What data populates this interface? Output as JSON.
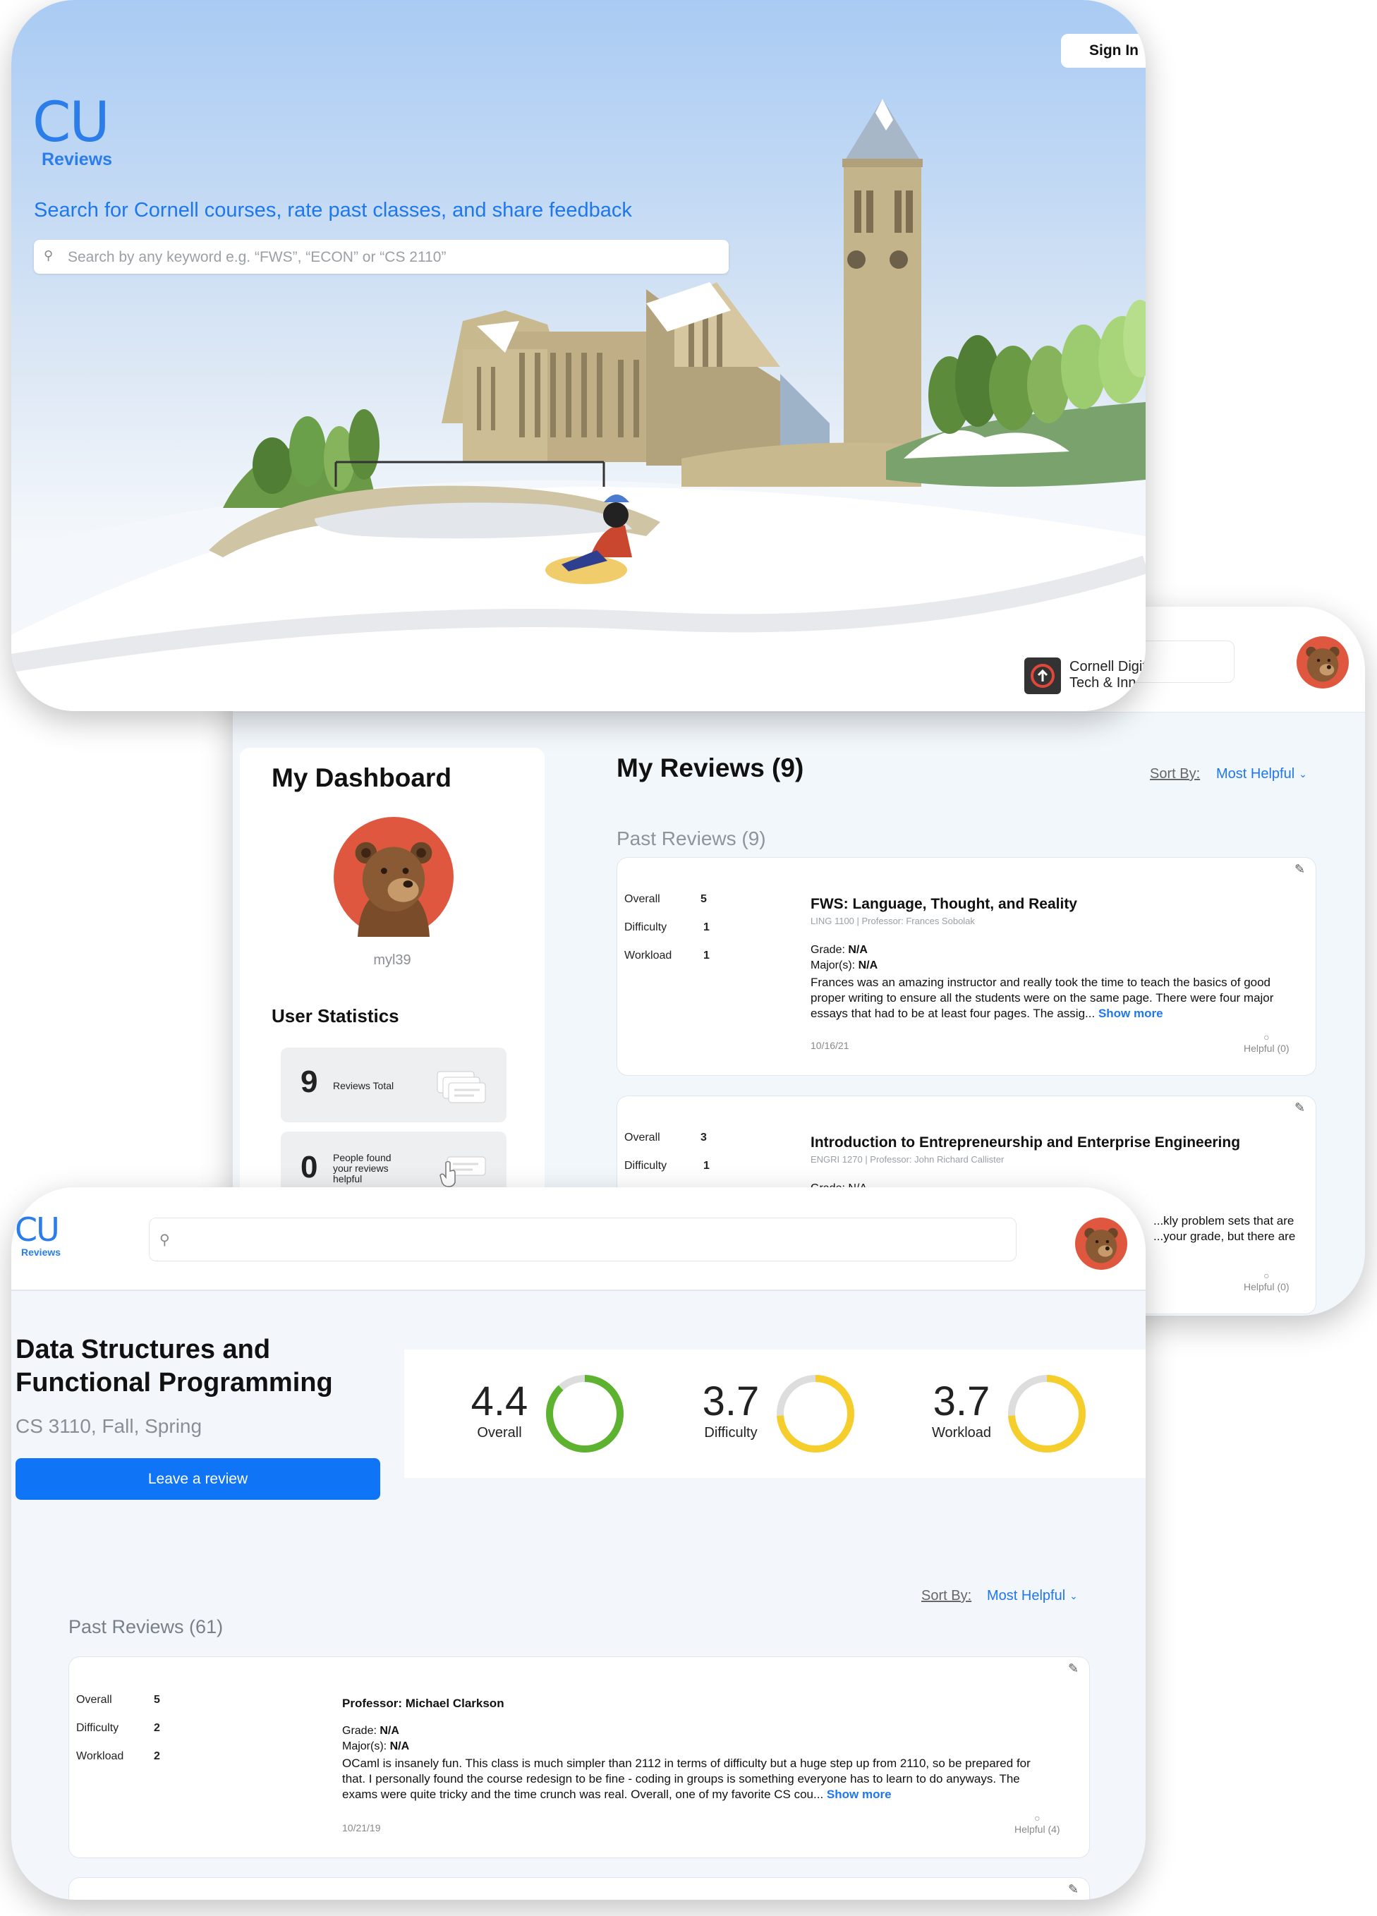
{
  "brand": {
    "logo": "CU",
    "sub": "Reviews"
  },
  "hero": {
    "sign_in": "Sign In",
    "tagline": "Search for Cornell courses, rate past classes, and share feedback",
    "search_placeholder": "Search by any keyword e.g. “FWS”, “ECON” or “CS 2110”",
    "partner_line1": "Cornell Digital",
    "partner_line2": "Tech & Innovation"
  },
  "dashboard": {
    "title": "My Dashboard",
    "username": "myl39",
    "stats_title": "User Statistics",
    "stats": [
      {
        "value": "9",
        "label": "Reviews Total"
      },
      {
        "value": "0",
        "label": "People found your reviews helpful"
      }
    ],
    "reviews_title": "My Reviews (9)",
    "sort_label": "Sort By:",
    "sort_value": "Most Helpful",
    "past_title": "Past Reviews (9)",
    "reviews": [
      {
        "overall_label": "Overall",
        "overall": "5",
        "difficulty_label": "Difficulty",
        "difficulty": "1",
        "workload_label": "Workload",
        "workload": "1",
        "title": "FWS: Language, Thought, and Reality",
        "subtitle": "LING 1100 | Professor: Frances Sobolak",
        "grade_label": "Grade:",
        "grade": "N/A",
        "major_label": "Major(s):",
        "major": "N/A",
        "text": "Frances was an amazing instructor and really took the time to teach the basics of good proper writing to ensure all the students were on the same page. There were four major essays that had to be at least four pages. The assig...",
        "more": "Show more",
        "date": "10/16/21",
        "helpful": "Helpful (0)"
      },
      {
        "overall_label": "Overall",
        "overall": "3",
        "difficulty_label": "Difficulty",
        "difficulty": "1",
        "title": "Introduction to Entrepreneurship and Enterprise Engineering",
        "subtitle": "ENGRI 1270 | Professor: John Richard Callister",
        "grade_partial": "Grade: N/A",
        "text_partial_1": "...kly problem sets that are",
        "text_partial_2": "...your grade, but there are",
        "helpful": "Helpful (0)"
      }
    ]
  },
  "course": {
    "title_line1": "Data Structures and",
    "title_line2": "Functional Programming",
    "code": "CS 3110, Fall, Spring",
    "cta": "Leave a review",
    "metrics": [
      {
        "value": "4.4",
        "label": "Overall",
        "fraction": 0.88,
        "color": "#5db32f"
      },
      {
        "value": "3.7",
        "label": "Difficulty",
        "fraction": 0.74,
        "color": "#f5ce2c"
      },
      {
        "value": "3.7",
        "label": "Workload",
        "fraction": 0.74,
        "color": "#f5ce2c"
      }
    ],
    "sort_label": "Sort By:",
    "sort_value": "Most Helpful",
    "past_title": "Past Reviews (61)",
    "review": {
      "overall_label": "Overall",
      "overall": "5",
      "difficulty_label": "Difficulty",
      "difficulty": "2",
      "workload_label": "Workload",
      "workload": "2",
      "professor": "Professor: Michael Clarkson",
      "grade_label": "Grade:",
      "grade": "N/A",
      "major_label": "Major(s):",
      "major": "N/A",
      "text": "OCaml is insanely fun. This class is much simpler than 2112 in terms of difficulty but a huge step up from 2110, so be prepared for that. I personally found the course redesign to be fine - coding in groups is something everyone has to learn to do anyways. The exams were quite tricky and the time crunch was real. Overall, one of my favorite CS cou...",
      "more": "Show more",
      "date": "10/21/19",
      "helpful": "Helpful (4)"
    }
  },
  "colors": {
    "accent": "#1f77ee",
    "brand": "#2b7de9",
    "green": "#5db32f",
    "yellow": "#f5ce2c",
    "avatar": "#e0573f"
  }
}
